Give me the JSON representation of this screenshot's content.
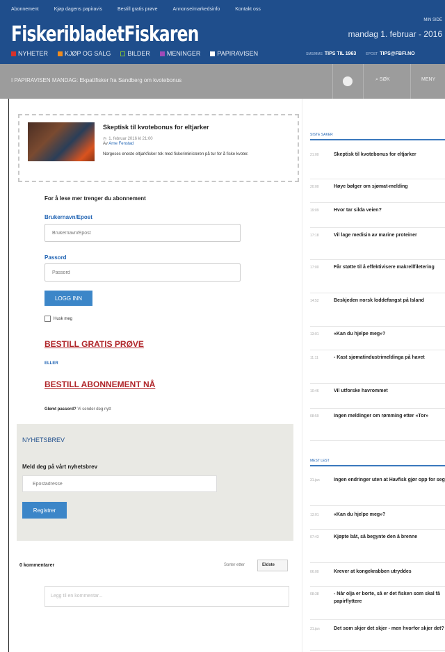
{
  "topnav": [
    "Abonnement",
    "Kjøp dagens papiravis",
    "Bestill gratis prøve",
    "Annonse/markedsinfo",
    "Kontakt oss"
  ],
  "login_link": "MIN SIDE",
  "logo": {
    "part1": "Fiskeribladet",
    "part2": "Fiskaren"
  },
  "date": "mandag 1. februar - 2016",
  "sections": [
    {
      "label": "NYHETER",
      "color": "#d6322b"
    },
    {
      "label": "KJØP OG SALG",
      "color": "#f08c1e"
    },
    {
      "label": "BILDER",
      "color": "#7cba3d"
    },
    {
      "label": "MENINGER",
      "color": "#a04ab8"
    },
    {
      "label": "PAPIRAVISEN",
      "color": "#ffffff"
    }
  ],
  "tips": [
    {
      "label": "SMS/MMS",
      "value": "TIPS TIL 1963"
    },
    {
      "label": "EPOST",
      "value": "TIPS@FBFI.NO"
    }
  ],
  "greybar": {
    "text": "I PAPIRAVISEN MANDAG: Ekpattfisker fra Sandberg om kvotebonus",
    "search": "SØK",
    "menu": "MENY"
  },
  "article": {
    "title": "Skeptisk til kvotebonus for eltjarker",
    "date": "1. februar 2016 kl 21:00",
    "author_prefix": "Av",
    "author": "Arne Fenstad",
    "desc": "Norgeses eneste eltjarkfisker tok med fiskeriministeren på tur for å fiske kvoter."
  },
  "login": {
    "intro": "For å lese mer trenger du abonnement",
    "user_label": "Brukernavn/Epost",
    "user_placeholder": "Brukernavn/Epost",
    "pass_label": "Passord",
    "pass_placeholder": "Passord",
    "button": "LOGG INN",
    "remember": "Husk meg",
    "free_trial": "BESTILL GRATIS PRØVE",
    "or": "ELLER",
    "subscribe": "BESTILL ABONNEMENT NÅ",
    "forgot_bold": "Glemt passord?",
    "forgot_rest": "Vi sender deg nytt"
  },
  "newsletter": {
    "heading": "NYHETSBREV",
    "sub": "Meld deg på vårt nyhetsbrev",
    "placeholder": "Epostadresse",
    "button": "Registrer"
  },
  "comments": {
    "count": "0 kommentarer",
    "sort_label": "Sorter etter",
    "sort_value": "Eldste",
    "placeholder": "Legg til en kommentar..."
  },
  "sidebar": {
    "latest_heading": "SISTE SAKER",
    "latest": [
      {
        "time": "21:00",
        "text": "Skeptisk til kvotebonus for eltjarker"
      },
      {
        "time": "20:00",
        "text": "Høye bølger om sjømat-melding"
      },
      {
        "time": "19:09",
        "text": "Hvor tar silda veien?"
      },
      {
        "time": "17:18",
        "text": "Vil lage medisin av marine proteiner"
      },
      {
        "time": "17:00",
        "text": "Får støtte til å effektivisere makrellfiletering"
      },
      {
        "time": "14:52",
        "text": "Beskjeden norsk loddefangst på Island"
      },
      {
        "time": "13:01",
        "text": "«Kan du hjelpe meg»?"
      },
      {
        "time": "11:11",
        "text": "- Kast sjømatindustrimeldinga på havet"
      },
      {
        "time": "10:46",
        "text": "Vil utforske havrommet"
      },
      {
        "time": "08:59",
        "text": "Ingen meldinger om rømming etter «Tor»"
      }
    ],
    "most_read_heading": "MEST LEST",
    "most_read": [
      {
        "time": "31.jan",
        "text": "Ingen endringer uten at Havfisk gjør opp for seg"
      },
      {
        "time": "13:01",
        "text": "«Kan du hjelpe meg»?"
      },
      {
        "time": "07:43",
        "text": "Kjøpte båt, så begynte den å brenne"
      },
      {
        "time": "06:00",
        "text": "Krever at kongekrabben utryddes"
      },
      {
        "time": "08:38",
        "text": "- Når olja er borte, så er det fisken som skal få papirflyttere"
      },
      {
        "time": "31.jan",
        "text": "Det som skjer det skjer - men hvorfor skjer det?"
      }
    ]
  }
}
